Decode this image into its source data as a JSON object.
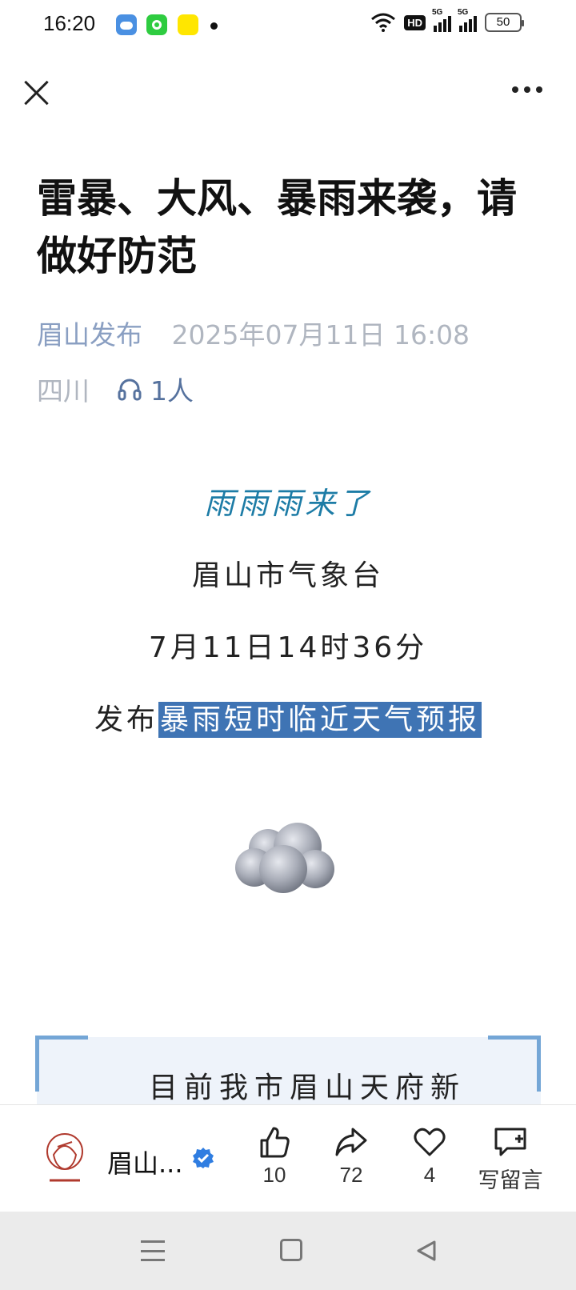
{
  "status_bar": {
    "time": "16:20",
    "hd_label": "HD",
    "signal_1": "5G",
    "signal_2": "5G",
    "battery": "50"
  },
  "nav": {
    "close_icon": "close-icon",
    "more_icon": "more-icon"
  },
  "article": {
    "title": "雷暴、大风、暴雨来袭，请做好防范",
    "account": "眉山发布",
    "datetime": "2025年07月11日 16:08",
    "location": "四川",
    "listeners": "1人",
    "subtitle": "雨雨雨来了",
    "line1": "眉山市气象台",
    "line2": "7月11日14时36分",
    "line3_prefix": "发布",
    "line3_highlight": "暴雨短时临近天气预报",
    "quote_text": "目前我市眉山天府新"
  },
  "action_bar": {
    "account_short": "眉山...",
    "likes": "10",
    "shares": "72",
    "favorites": "4",
    "comment_label": "写留言"
  },
  "colors": {
    "accent": "#3f74b4",
    "subtitle": "#1d7ca6",
    "meta": "#b0b6c0",
    "account": "#8a9fc2",
    "quote_bg": "#eef3fa",
    "quote_border": "#74a6d6"
  }
}
